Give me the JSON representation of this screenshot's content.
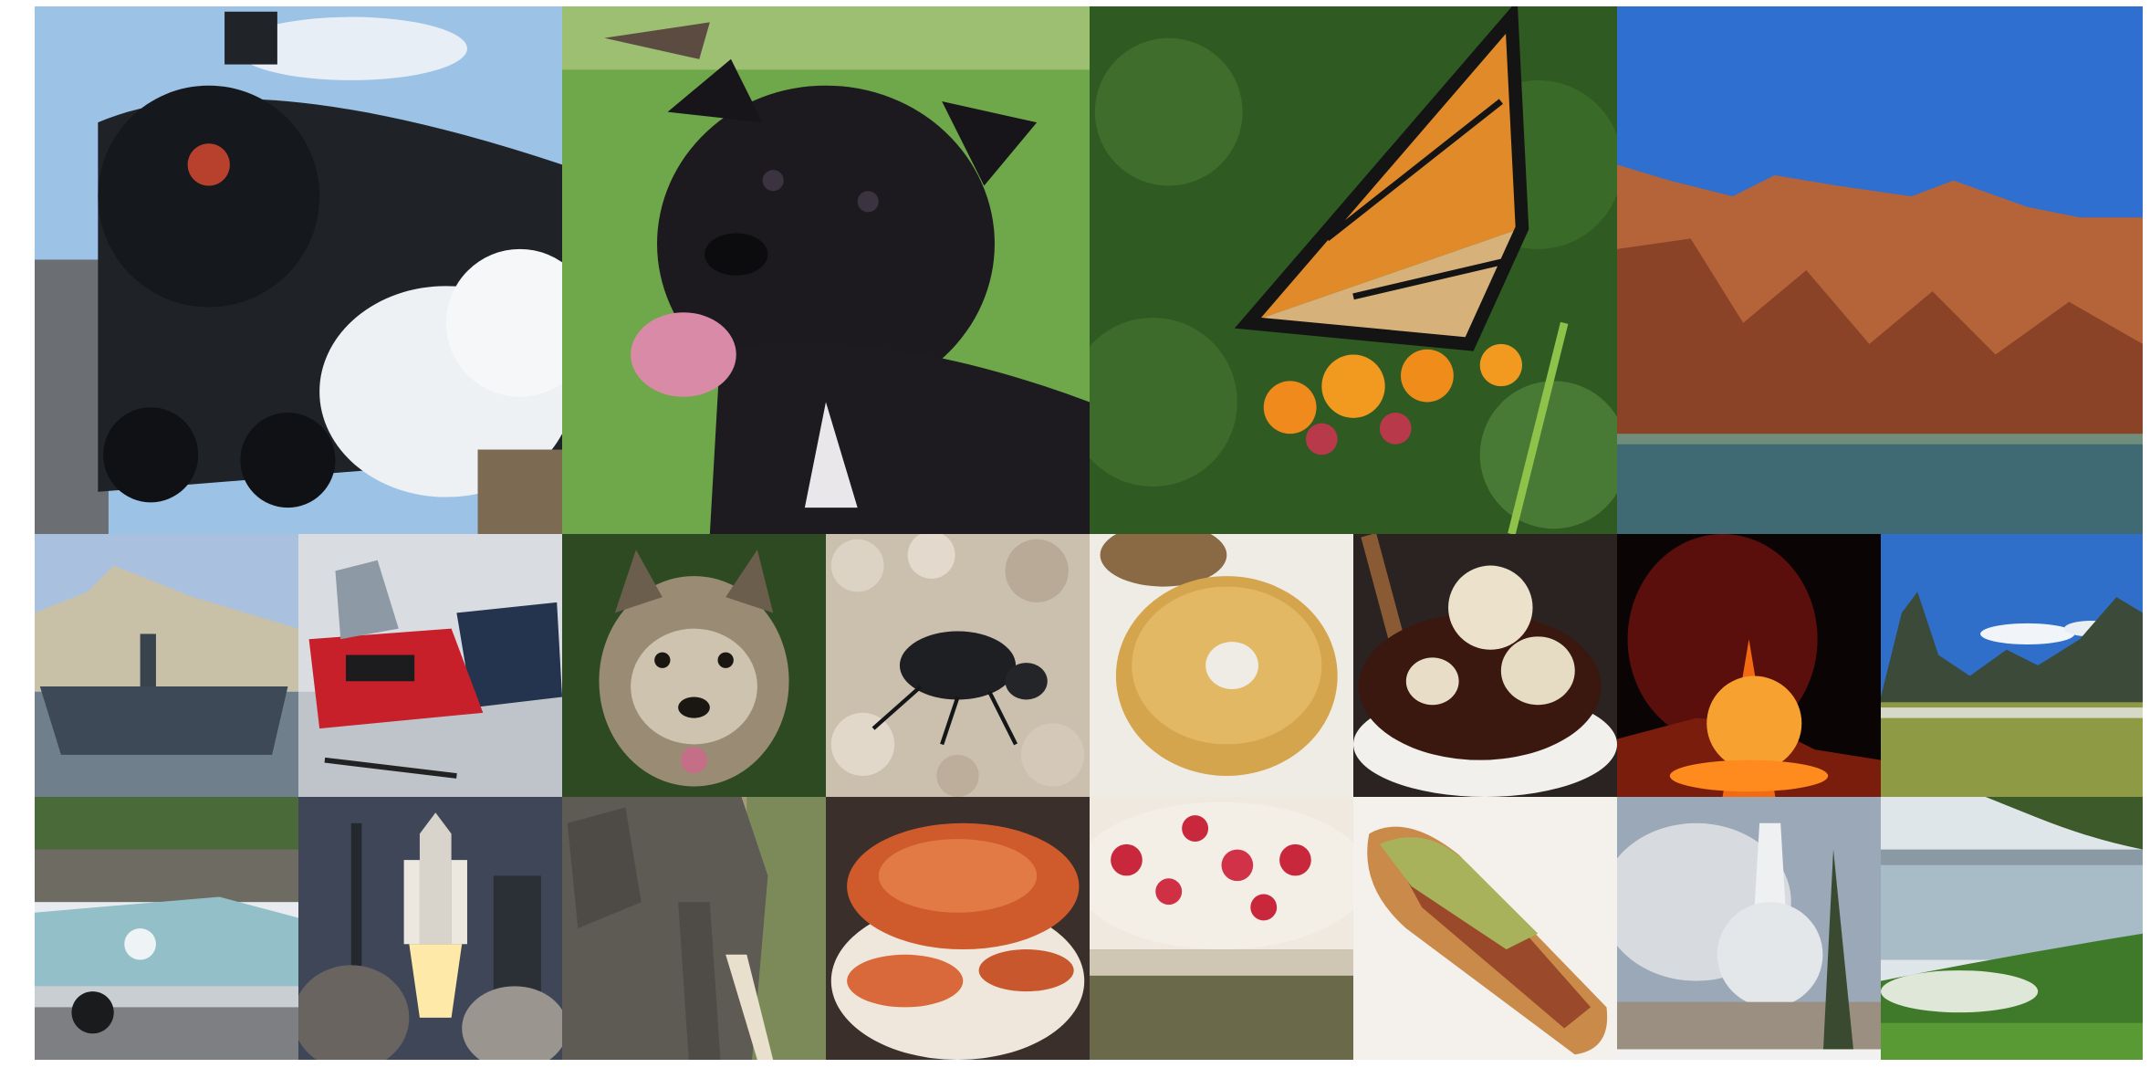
{
  "mosaic": {
    "background": "#ffffff",
    "large_tiles": [
      {
        "subject": "steam-locomotive"
      },
      {
        "subject": "black-dog"
      },
      {
        "subject": "monarch-butterfly"
      },
      {
        "subject": "red-cliffs-by-lake"
      }
    ],
    "small_tiles_row_1": [
      {
        "subject": "aircraft-carrier"
      },
      {
        "subject": "snowmobiles"
      },
      {
        "subject": "cairn-terrier"
      },
      {
        "subject": "ground-beetle"
      },
      {
        "subject": "bagel"
      },
      {
        "subject": "ice-cream-sundae"
      },
      {
        "subject": "volcano-eruption"
      },
      {
        "subject": "mountain-valley"
      }
    ],
    "small_tiles_row_2": [
      {
        "subject": "vintage-convertible-car"
      },
      {
        "subject": "space-shuttle-launch"
      },
      {
        "subject": "elephant"
      },
      {
        "subject": "cooked-crab"
      },
      {
        "subject": "strawberry-trifle"
      },
      {
        "subject": "hot-dog"
      },
      {
        "subject": "geyser"
      },
      {
        "subject": "lakeside-garden"
      }
    ]
  }
}
